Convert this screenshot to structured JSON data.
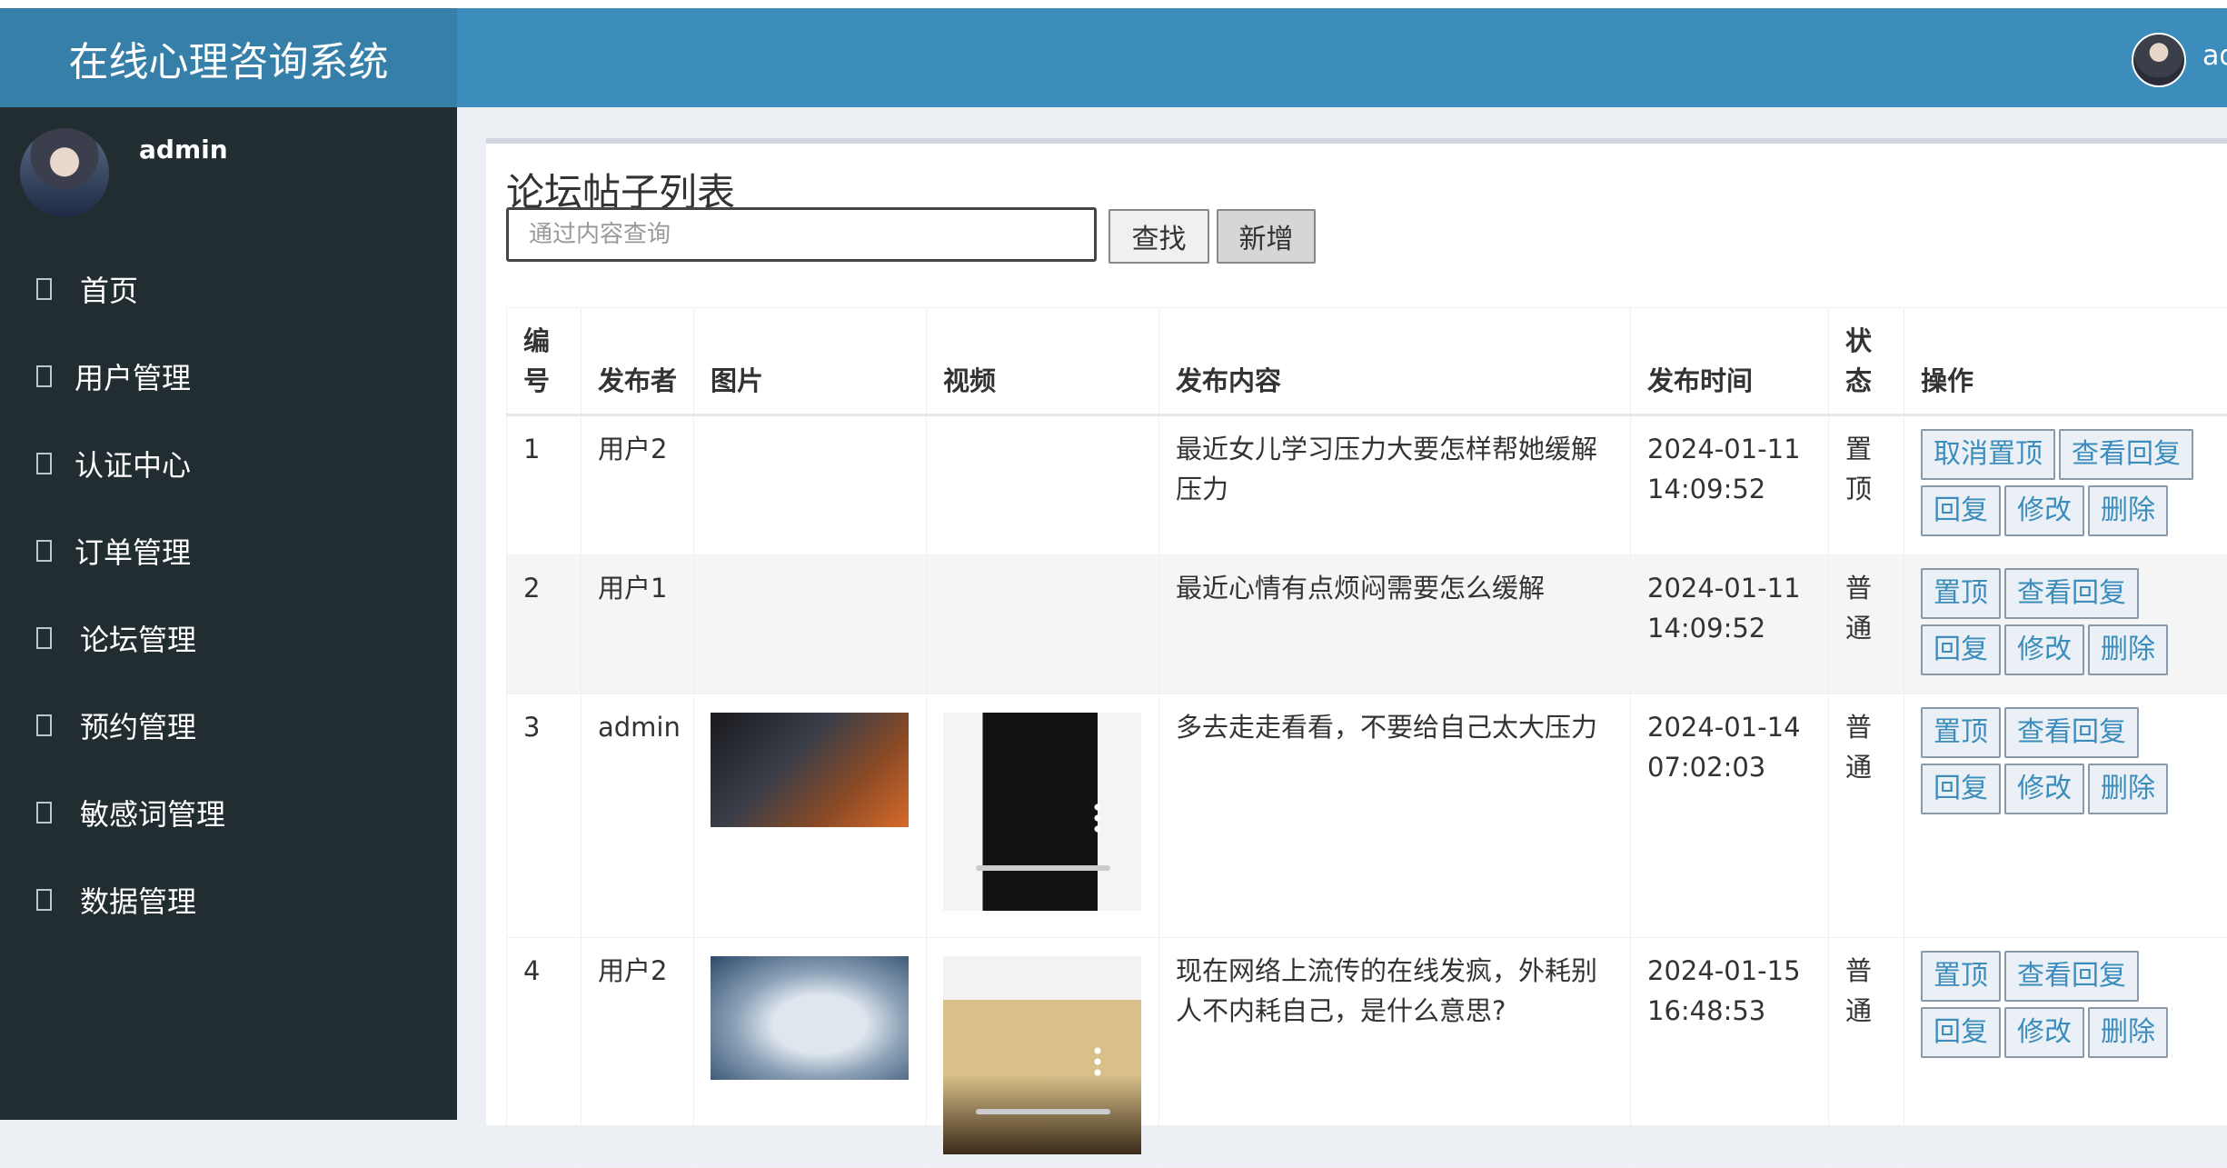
{
  "app": {
    "title": "在线心理咨询系统",
    "user": "admin"
  },
  "sidebar": {
    "user_name": "admin",
    "items": [
      {
        "label": "首页"
      },
      {
        "label": "用户管理"
      },
      {
        "label": "认证中心"
      },
      {
        "label": "订单管理"
      },
      {
        "label": "论坛管理"
      },
      {
        "label": "预约管理"
      },
      {
        "label": "敏感词管理"
      },
      {
        "label": "数据管理"
      }
    ]
  },
  "main": {
    "title": "论坛帖子列表",
    "search_placeholder": "通过内容查询",
    "find_label": "查找",
    "add_label": "新增",
    "columns": [
      "编号",
      "发布者",
      "图片",
      "视频",
      "发布内容",
      "发布时间",
      "状态",
      "操作"
    ],
    "rows": [
      {
        "id": "1",
        "author": "用户2",
        "image": "",
        "video": "",
        "content": "最近女儿学习压力大要怎样帮她缓解压力",
        "time": "2024-01-11 14:09:52",
        "status": "置顶",
        "actions": [
          "取消置顶",
          "查看回复",
          "回复",
          "修改",
          "删除"
        ]
      },
      {
        "id": "2",
        "author": "用户1",
        "image": "",
        "video": "",
        "content": "最近心情有点烦闷需要怎么缓解",
        "time": "2024-01-11 14:09:52",
        "status": "普通",
        "actions": [
          "置顶",
          "查看回复",
          "回复",
          "修改",
          "删除"
        ]
      },
      {
        "id": "3",
        "author": "admin",
        "image": "space-image",
        "video": "video-thumb",
        "content": "多去走走看看，不要给自己太大压力",
        "time": "2024-01-14 07:02:03",
        "status": "普通",
        "actions": [
          "置顶",
          "查看回复",
          "回复",
          "修改",
          "删除"
        ]
      },
      {
        "id": "4",
        "author": "用户2",
        "image": "leopard-image",
        "video": "video-thumb",
        "content": "现在网络上流传的在线发疯，外耗别人不内耗自己，是什么意思?",
        "time": "2024-01-15 16:48:53",
        "status": "普通",
        "actions": [
          "置顶",
          "查看回复",
          "回复",
          "修改",
          "删除"
        ]
      }
    ]
  }
}
